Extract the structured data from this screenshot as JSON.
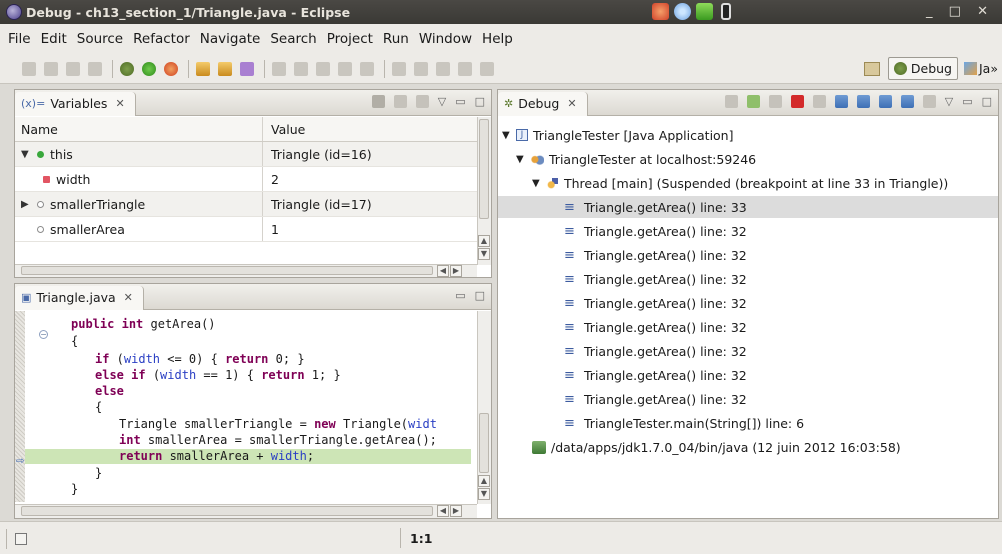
{
  "window": {
    "title": "Debug - ch13_section_1/Triangle.java - Eclipse"
  },
  "menu": [
    "File",
    "Edit",
    "Source",
    "Refactor",
    "Navigate",
    "Search",
    "Project",
    "Run",
    "Window",
    "Help"
  ],
  "perspectives": {
    "debug": "Debug",
    "java": "Ja",
    "more": "»"
  },
  "variables_view": {
    "tab_label": "Variables",
    "columns": [
      "Name",
      "Value"
    ],
    "rows": [
      {
        "name": "this",
        "value": "Triangle (id=16)",
        "expander": "▼"
      },
      {
        "name": "width",
        "value": "2",
        "expander": ""
      },
      {
        "name": "smallerTriangle",
        "value": "Triangle (id=17)",
        "expander": "▶"
      },
      {
        "name": "smallerArea",
        "value": "1",
        "expander": ""
      }
    ]
  },
  "editor": {
    "tab_label": "Triangle.java",
    "lines": [
      "public int getArea()",
      "{",
      "if (width <= 0) { return 0; }",
      "else if (width == 1) { return 1; }",
      "else",
      "{",
      "Triangle smallerTriangle = new Triangle(widt",
      "int smallerArea = smallerTriangle.getArea();",
      "return smallerArea + width;",
      "}",
      "}"
    ]
  },
  "debug_view": {
    "tab_label": "Debug",
    "tree": {
      "app": "TriangleTester [Java Application]",
      "vm": "TriangleTester at localhost:59246",
      "thread": "Thread [main] (Suspended (breakpoint at line 33 in Triangle))",
      "frames": [
        "Triangle.getArea() line: 33",
        "Triangle.getArea() line: 32",
        "Triangle.getArea() line: 32",
        "Triangle.getArea() line: 32",
        "Triangle.getArea() line: 32",
        "Triangle.getArea() line: 32",
        "Triangle.getArea() line: 32",
        "Triangle.getArea() line: 32",
        "Triangle.getArea() line: 32",
        "TriangleTester.main(String[]) line: 6"
      ],
      "process": "/data/apps/jdk1.7.0_04/bin/java (12 juin 2012 16:03:58)"
    }
  },
  "status_bar": {
    "position": "1:1"
  },
  "colors": {
    "selection": "#dcdcdc",
    "current_line": "#cde5b6",
    "keyword": "#7f0055",
    "field": "#2a3fc4"
  }
}
